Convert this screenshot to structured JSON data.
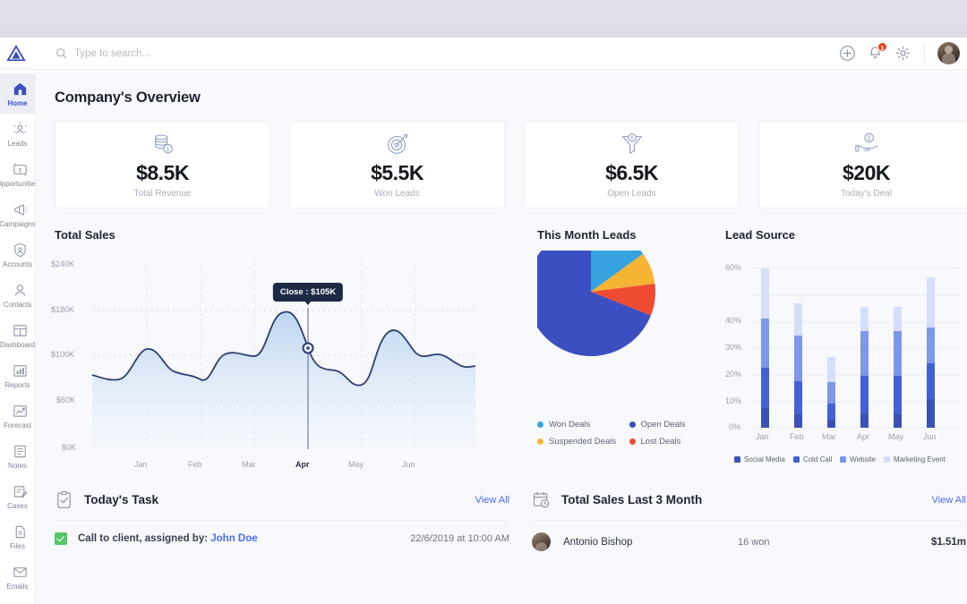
{
  "app": {
    "logo_icon": "delta-triangle-logo"
  },
  "search": {
    "placeholder": "Type to search...",
    "value": ""
  },
  "topbar": {
    "add_icon": "plus-circle-icon",
    "notifications_icon": "bell-icon",
    "notifications_count": "1",
    "settings_icon": "gear-icon",
    "avatar": "user-avatar"
  },
  "sidebar": {
    "items": [
      {
        "label": "Home",
        "icon": "home-icon",
        "active": true
      },
      {
        "label": "Leads",
        "icon": "leads-network-icon",
        "active": false
      },
      {
        "label": "Opportunities",
        "icon": "money-exchange-icon",
        "active": false
      },
      {
        "label": "Campaigns",
        "icon": "megaphone-icon",
        "active": false
      },
      {
        "label": "Accounts",
        "icon": "shield-user-icon",
        "active": false
      },
      {
        "label": "Contacts",
        "icon": "person-icon",
        "active": false
      },
      {
        "label": "Dashboard",
        "icon": "dashboard-grid-icon",
        "active": false
      },
      {
        "label": "Reports",
        "icon": "bar-chart-icon",
        "active": false
      },
      {
        "label": "Forecast",
        "icon": "trend-up-icon",
        "active": false
      },
      {
        "label": "Notes",
        "icon": "notes-icon",
        "active": false
      },
      {
        "label": "Cases",
        "icon": "case-pencil-icon",
        "active": false
      },
      {
        "label": "Files",
        "icon": "file-icon",
        "active": false
      },
      {
        "label": "Emails",
        "icon": "envelope-icon",
        "active": false
      }
    ]
  },
  "page": {
    "title": "Company's Overview"
  },
  "stat_cards": [
    {
      "value": "$8.5K",
      "label": "Total Revenue",
      "icon": "coins-stack-dollar-icon"
    },
    {
      "value": "$5.5K",
      "label": "Won Leads",
      "icon": "target-arrow-icon"
    },
    {
      "value": "$6.5K",
      "label": "Open Leads",
      "icon": "funnel-dollar-icon"
    },
    {
      "value": "$20K",
      "label": "Today's Deal",
      "icon": "hand-dollar-icon"
    }
  ],
  "chart_data": [
    {
      "type": "area",
      "title": "Total Sales",
      "xlabel": "",
      "ylabel": "",
      "x": [
        "Jan",
        "Feb",
        "Mar",
        "Apr",
        "May",
        "Jun"
      ],
      "ytick_labels": [
        "$240K",
        "$180K",
        "$100K",
        "$60K",
        "$0K"
      ],
      "ylim": [
        0,
        240
      ],
      "grid": true,
      "highlight": {
        "x": "Apr",
        "label": "Close : $105K",
        "value": 105
      },
      "series": [
        {
          "name": "Total Sales",
          "line_color": "#2d3f72",
          "fill_color": "#cfe0f5",
          "values": [
            88,
            113,
            88,
            78,
            110,
            106,
            165,
            105,
            92,
            150,
            128,
            120
          ]
        }
      ]
    },
    {
      "type": "pie",
      "title": "This Month Leads",
      "labels": [
        "Won Deals",
        "Open Deals",
        "Suspended Deals",
        "Lost Deals"
      ],
      "values": [
        15,
        69,
        8,
        8
      ],
      "colors": [
        "#37a2e0",
        "#3b4fc0",
        "#f5b433",
        "#ef4a32"
      ],
      "legend_position": "bottom"
    },
    {
      "type": "bar",
      "title": "Lead Source",
      "stacked": true,
      "categories": [
        "Jan",
        "Feb",
        "Mar",
        "Apr",
        "May",
        "Jun"
      ],
      "ytick_labels": [
        "0%",
        "10%",
        "20%",
        "30%",
        "40%",
        "60%"
      ],
      "ylim": [
        0,
        60
      ],
      "grid": true,
      "series": [
        {
          "name": "Social Media",
          "color": "#3c51b5",
          "values": [
            7.5,
            5,
            3,
            5,
            5,
            11
          ]
        },
        {
          "name": "Cold Call",
          "color": "#4461d4",
          "values": [
            15,
            12.5,
            6,
            14.5,
            14.5,
            13.5
          ]
        },
        {
          "name": "Website",
          "color": "#7e97ea",
          "values": [
            18.5,
            17,
            8,
            17,
            17,
            13.5
          ]
        },
        {
          "name": "Marketing Event",
          "color": "#d6deff",
          "values": [
            19,
            12,
            9.5,
            9,
            9,
            19
          ]
        }
      ]
    }
  ],
  "tasks_panel": {
    "title": "Today's Task",
    "icon": "clipboard-check-icon",
    "view_all": "View All",
    "rows": [
      {
        "text": "Call to client, assigned by: ",
        "assignee": "John Doe",
        "date": "22/6/2019 at 10:00 AM",
        "done": true
      }
    ]
  },
  "sales3_panel": {
    "title": "Total Sales Last 3 Month",
    "icon": "calendar-clock-icon",
    "view_all": "View All",
    "rows": [
      {
        "name": "Antonio Bishop",
        "won": "16 won",
        "amount": "$1.51m"
      }
    ]
  }
}
